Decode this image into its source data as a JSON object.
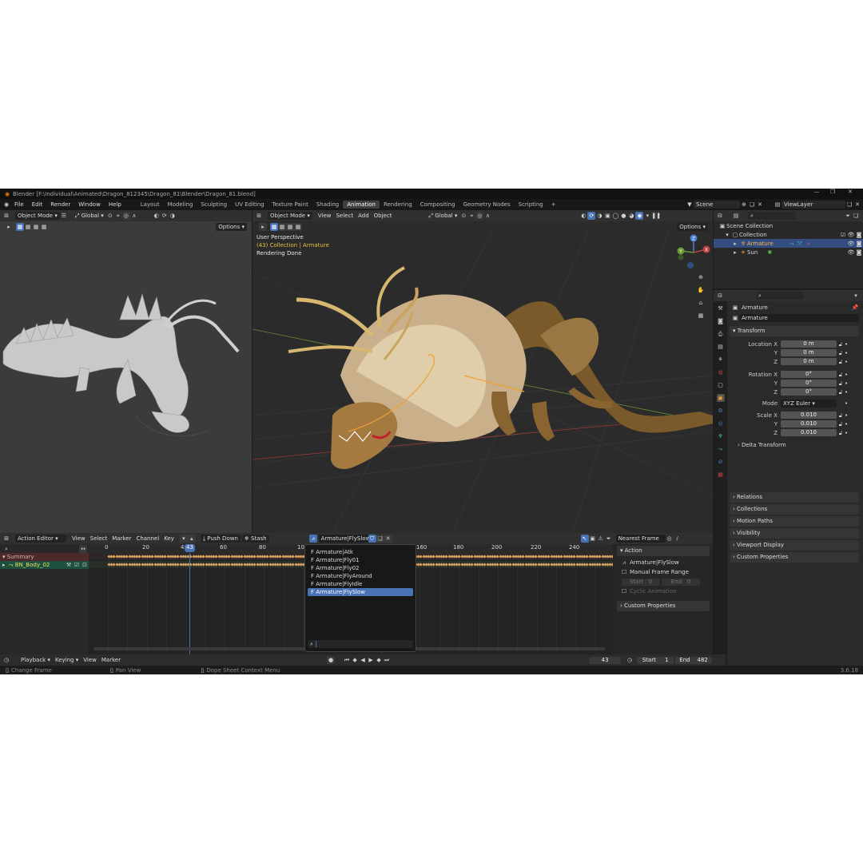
{
  "window": {
    "title": "Blender [F:\\Individual\\Animated\\Dragon_812345\\Dragon_81\\Blender\\Dragon_81.blend]",
    "minimize": "—",
    "maximize": "❐",
    "close": "✕"
  },
  "menus": [
    "File",
    "Edit",
    "Render",
    "Window",
    "Help"
  ],
  "workspaces": [
    "Layout",
    "Modeling",
    "Sculpting",
    "UV Editing",
    "Texture Paint",
    "Shading",
    "Animation",
    "Rendering",
    "Compositing",
    "Geometry Nodes",
    "Scripting"
  ],
  "active_workspace": "Animation",
  "add_workspace": "+",
  "scene": {
    "scene_name": "Scene",
    "view_layer": "ViewLayer"
  },
  "left_viewport": {
    "mode": "Object Mode",
    "orientation": "Global",
    "options": "Options"
  },
  "main_viewport": {
    "mode": "Object Mode",
    "menus": [
      "View",
      "Select",
      "Add",
      "Object"
    ],
    "orientation": "Global",
    "options": "Options",
    "overlay_line1": "User Perspective",
    "overlay_line2": "(43) Collection | Armature",
    "overlay_line3": "Rendering Done",
    "gizmo": {
      "x": "X",
      "y": "Y",
      "z": "Z"
    }
  },
  "outliner": {
    "search_placeholder": "",
    "rows": [
      {
        "label": "Scene Collection"
      },
      {
        "label": "Collection"
      },
      {
        "label": "Armature"
      },
      {
        "label": "Sun"
      }
    ]
  },
  "properties": {
    "object_name": "Armature",
    "data_name": "Armature",
    "transform_header": "Transform",
    "location": {
      "label_x": "Location X",
      "label_y": "Y",
      "label_z": "Z",
      "x": "0 m",
      "y": "0 m",
      "z": "0 m"
    },
    "rotation": {
      "label_x": "Rotation X",
      "label_y": "Y",
      "label_z": "Z",
      "x": "0°",
      "y": "0°",
      "z": "0°"
    },
    "mode_label": "Mode",
    "mode_value": "XYZ Euler",
    "scale": {
      "label_x": "Scale X",
      "label_y": "Y",
      "label_z": "Z",
      "x": "0.010",
      "y": "0.010",
      "z": "0.010"
    },
    "delta_transform": "Delta Transform",
    "panels": [
      "Relations",
      "Collections",
      "Motion Paths",
      "Visibility",
      "Viewport Display",
      "Custom Properties"
    ]
  },
  "action_editor": {
    "mode": "Action Editor",
    "menus": [
      "View",
      "Select",
      "Marker",
      "Channel",
      "Key"
    ],
    "push_down": "Push Down",
    "stash": "Stash",
    "action_name": "Armature|FlySlow",
    "snapping": "Nearest Frame",
    "ruler": [
      "0",
      "20",
      "40",
      "60",
      "80",
      "100",
      "160",
      "180",
      "200",
      "220",
      "240"
    ],
    "current_frame_badge": "43",
    "channels": [
      {
        "label": "Summary"
      },
      {
        "label": "BN_Body_02"
      }
    ],
    "dropdown_items": [
      "Armature|Atk",
      "Armature|Fly01",
      "Armature|Fly02",
      "Armature|FlyAround",
      "Armature|FlyIdle",
      "Armature|FlySlow"
    ],
    "dropdown_item_prefix": "F",
    "dropdown_selected": 5,
    "side": {
      "action_header": "Action",
      "action_value": "Armature|FlySlow",
      "manual_range": "Manual Frame Range",
      "start_label": "Start",
      "start_value": "0",
      "end_label": "End",
      "end_value": "0",
      "cyclic": "Cyclic Animation",
      "custom_props": "Custom Properties"
    }
  },
  "timeline": {
    "menus": [
      "Playback",
      "Keying",
      "View",
      "Marker"
    ],
    "current_frame": "43",
    "start_label": "Start",
    "start_value": "1",
    "end_label": "End",
    "end_value": "482"
  },
  "status": {
    "left": "Change Frame",
    "middle": "Pan View",
    "right": "Dope Sheet Context Menu",
    "version": "3.6.18"
  },
  "colors": {
    "accent": "#4772b3",
    "header": "#303030",
    "background": "#1d1d1d",
    "keyframe": "#d9a060"
  }
}
